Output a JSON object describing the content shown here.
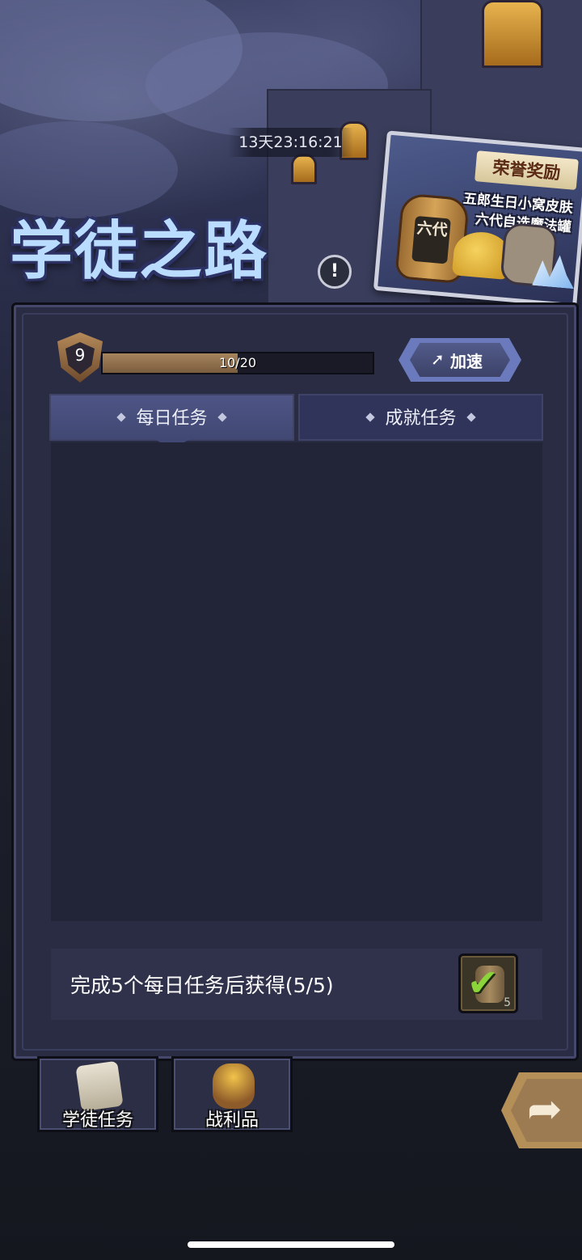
{
  "countdown": "13天23:16:21",
  "title": "学徒之路",
  "honor_reward": {
    "title": "荣誉奖励",
    "line1": "五郎生日小窝皮肤",
    "line2": "六代自选魔法罐",
    "jar_label": "六代"
  },
  "level": {
    "number": "9",
    "progress_text": "10/20",
    "progress_fraction": 0.5
  },
  "speed_button": {
    "label": "加速"
  },
  "tabs": [
    {
      "label": "每日任务",
      "active": true
    },
    {
      "label": "成就任务",
      "active": false
    }
  ],
  "daily_reward": {
    "text": "完成5个每日任务后获得(5/5)",
    "count": "5"
  },
  "bottom_nav": [
    {
      "label": "学徒任务"
    },
    {
      "label": "战利品"
    }
  ],
  "icons": {
    "info": "exclamation-icon",
    "speed": "lightning-icon",
    "check": "check-icon",
    "share": "share-arrow-icon"
  },
  "colors": {
    "panel": "#2a2c43",
    "progress_fill": "#a6845e",
    "tab_active": "#4e5585",
    "check_green": "#8bd43a"
  }
}
